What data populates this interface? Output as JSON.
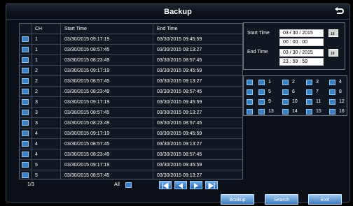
{
  "window": {
    "title": "Backup"
  },
  "table": {
    "headers": {
      "ch": "CH",
      "start": "Start Time",
      "end": "End Time"
    },
    "rows": [
      {
        "ch": "1",
        "start": "03/30/2015  09:17:19",
        "end": "03/30/2015  09:45:59"
      },
      {
        "ch": "1",
        "start": "03/30/2015  08:57:45",
        "end": "03/30/2015  09:13:27"
      },
      {
        "ch": "1",
        "start": "03/30/2015  08:23:49",
        "end": "03/30/2015  08:57:45"
      },
      {
        "ch": "2",
        "start": "03/30/2015  09:17:19",
        "end": "03/30/2015  09:45:59"
      },
      {
        "ch": "2",
        "start": "03/30/2015  08:57:45",
        "end": "03/30/2015  09:13:27"
      },
      {
        "ch": "2",
        "start": "03/30/2015  08:23:49",
        "end": "03/30/2015  08:57:45"
      },
      {
        "ch": "3",
        "start": "03/30/2015  09:17:19",
        "end": "03/30/2015  09:45:59"
      },
      {
        "ch": "3",
        "start": "03/30/2015  08:57:45",
        "end": "03/30/2015  09:13:27"
      },
      {
        "ch": "3",
        "start": "03/30/2015  08:23:49",
        "end": "03/30/2015  08:57:45"
      },
      {
        "ch": "4",
        "start": "03/30/2015  09:17:19",
        "end": "03/30/2015  09:45:59"
      },
      {
        "ch": "4",
        "start": "03/30/2015  08:57:45",
        "end": "03/30/2015  09:13:27"
      },
      {
        "ch": "4",
        "start": "03/30/2015  08:23:49",
        "end": "03/30/2015  08:57:45"
      },
      {
        "ch": "5",
        "start": "03/30/2015  09:17:19",
        "end": "03/30/2015  09:45:59"
      },
      {
        "ch": "5",
        "start": "03/30/2015  08:57:45",
        "end": "03/30/2015  09:13:27"
      }
    ]
  },
  "pager": {
    "page": "1/3",
    "all_label": "All"
  },
  "time": {
    "start_label": "Start Time",
    "start_date": "03  /  30  /  2015",
    "start_time": "00  :  00  :  00",
    "end_label": "End Time",
    "end_date": "03  /  30  /  2015",
    "end_time": "23  :  59  :  59",
    "calendar_text": "18"
  },
  "channels": [
    "1",
    "2",
    "3",
    "4",
    "5",
    "6",
    "7",
    "8",
    "9",
    "10",
    "11",
    "12",
    "13",
    "14",
    "15",
    "16"
  ],
  "buttons": {
    "backup": "Bcakup",
    "search": "Search",
    "exit": "Exit"
  },
  "colors": {
    "accent": "#3b7fc5",
    "panel": "#101721",
    "border": "#566273"
  }
}
